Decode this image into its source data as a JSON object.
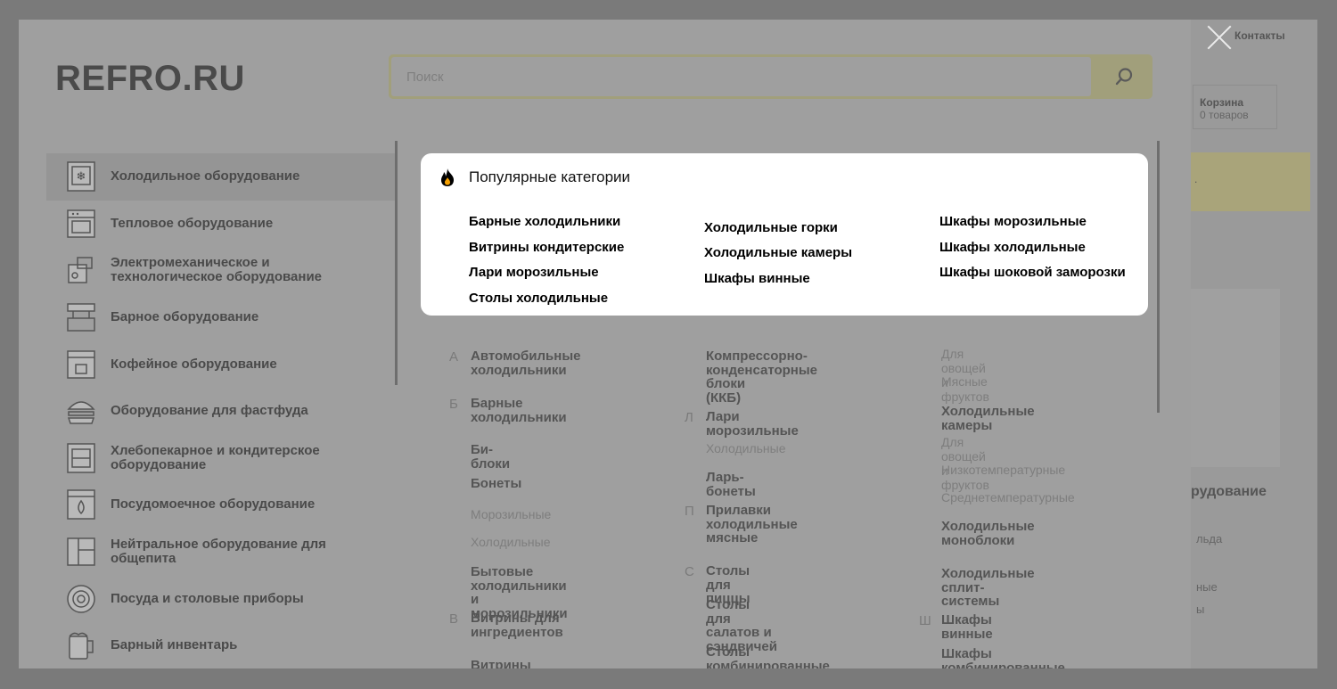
{
  "background_page": {
    "contacts": "Контакты",
    "cart_title": "Корзина",
    "cart_count": "0 товаров",
    "section_heading": "рудование",
    "line1": "льда",
    "line2": "ные",
    "line3": "ы"
  },
  "modal": {
    "logo": "REFRO.RU",
    "search": {
      "placeholder": "Поиск"
    },
    "sidebar": [
      {
        "label": "Холодильное оборудование",
        "icon": "fridge-icon"
      },
      {
        "label": "Тепловое оборудование",
        "icon": "oven-icon"
      },
      {
        "label": "Электромеханическое и\nтехнологическое оборудование",
        "icon": "meat-grinder-icon"
      },
      {
        "label": "Барное оборудование",
        "icon": "bar-equipment-icon"
      },
      {
        "label": "Кофейное оборудование",
        "icon": "coffee-machine-icon"
      },
      {
        "label": "Оборудование для фастфуда",
        "icon": "burger-icon"
      },
      {
        "label": "Хлебопекарное и кондитерское\nоборудование",
        "icon": "bakery-oven-icon"
      },
      {
        "label": "Посудомоечное оборудование",
        "icon": "dishwasher-icon"
      },
      {
        "label": "Нейтральное оборудование для\nобщепита",
        "icon": "neutral-cabinet-icon"
      },
      {
        "label": "Посуда и столовые приборы",
        "icon": "plate-icon"
      },
      {
        "label": "Барный инвентарь",
        "icon": "beer-mug-icon"
      }
    ],
    "popular": {
      "title": "Популярные категории",
      "col1": [
        "Барные холодильники",
        "Витрины кондитерские",
        "Лари морозильные",
        "Столы холодильные"
      ],
      "col2": [
        "Холодильные горки",
        "Холодильные камеры",
        "Шкафы винные"
      ],
      "col3": [
        "Шкафы морозильные",
        "Шкафы холодильные",
        "Шкафы шоковой заморозки"
      ]
    },
    "catalog": {
      "letters": {
        "a": "А",
        "b": "Б",
        "v": "В",
        "l": "Л",
        "p": "П",
        "s": "С",
        "sh": "Ш"
      },
      "col1": {
        "avto": "Автомобильные\nхолодильники",
        "bar": "Барные\nхолодильники",
        "biblok": "Би-блоки",
        "bonety": "Бонеты",
        "bonety_sub1": "Морозильные",
        "bonety_sub2": "Холодильные",
        "bytovye": "Бытовые холодильники\nи морозильники",
        "vitriny_ingr": "Витрины для\nингредиентов",
        "vitriny_kond": "Витрины кондитерские"
      },
      "col2": {
        "kkb": "Компрессорно-\nконденсаторные блоки\n(ККБ)",
        "lari": "Лари морозильные",
        "lari_sub": "Холодильные",
        "lar_bonety": "Ларь-бонеты",
        "prilavki": "Прилавки\nхолодильные\nмясные",
        "stoly_pizza": "Столы для пиццы",
        "stoly_salat": "Столы для салатов и\nсэндвичей",
        "stoly_komb": "Столы\nкомбинированные"
      },
      "col3": {
        "sub_ovoshi": "Для овощей и фруктов",
        "sub_myasnye": "Мясные",
        "kamery": "Холодильные камеры",
        "kamery_sub1": "Для овощей и фруктов",
        "kamery_sub2": "Низкотемпературные",
        "kamery_sub3": "Среднетемпературные",
        "monobloki": "Холодильные\nмоноблоки",
        "split": "Холодильные сплит-\nсистемы",
        "shkafy_vinnye": "Шкафы винные",
        "shkafy_komb": "Шкафы\nкомбинированные"
      }
    }
  },
  "colors": {
    "overlay": "#7a7a7a",
    "modal_bg": "#9f9f9f",
    "popular_bg": "#ffffff",
    "fire": "#f5a000"
  }
}
